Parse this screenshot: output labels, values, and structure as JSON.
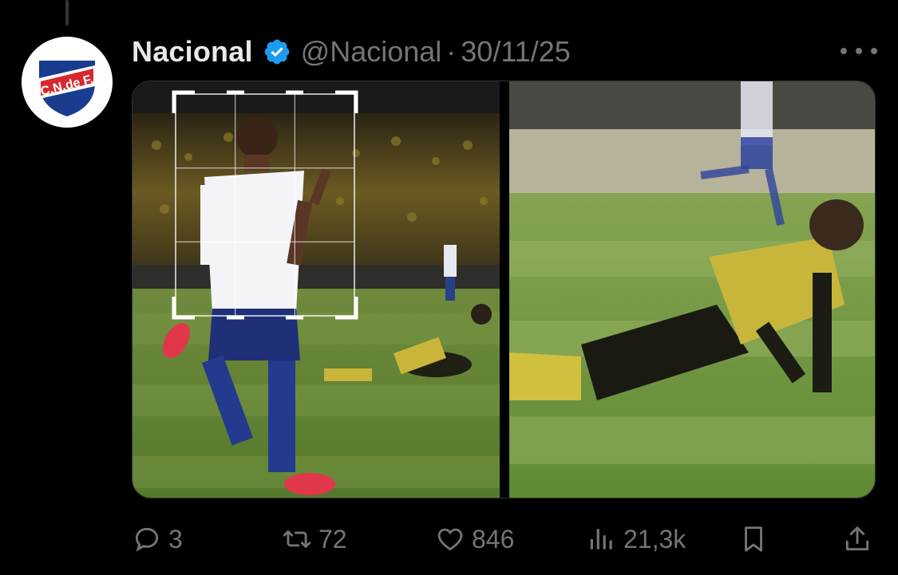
{
  "post": {
    "display_name": "Nacional",
    "handle": "@Nacional",
    "separator": "·",
    "date": "30/11/25",
    "avatar_text": "C.N.de F.",
    "verified": true,
    "accent_color": "#1d9bf0"
  },
  "media": {
    "images": [
      {
        "description": "celebrating-player-with-crop-grid"
      },
      {
        "description": "fallen-player-on-pitch"
      }
    ]
  },
  "actions": {
    "replies": "3",
    "reposts": "72",
    "likes": "846",
    "views": "21,3k"
  },
  "icons": [
    "reply-icon",
    "repost-icon",
    "like-icon",
    "views-icon",
    "bookmark-icon",
    "share-icon",
    "more-icon",
    "verified-icon"
  ]
}
